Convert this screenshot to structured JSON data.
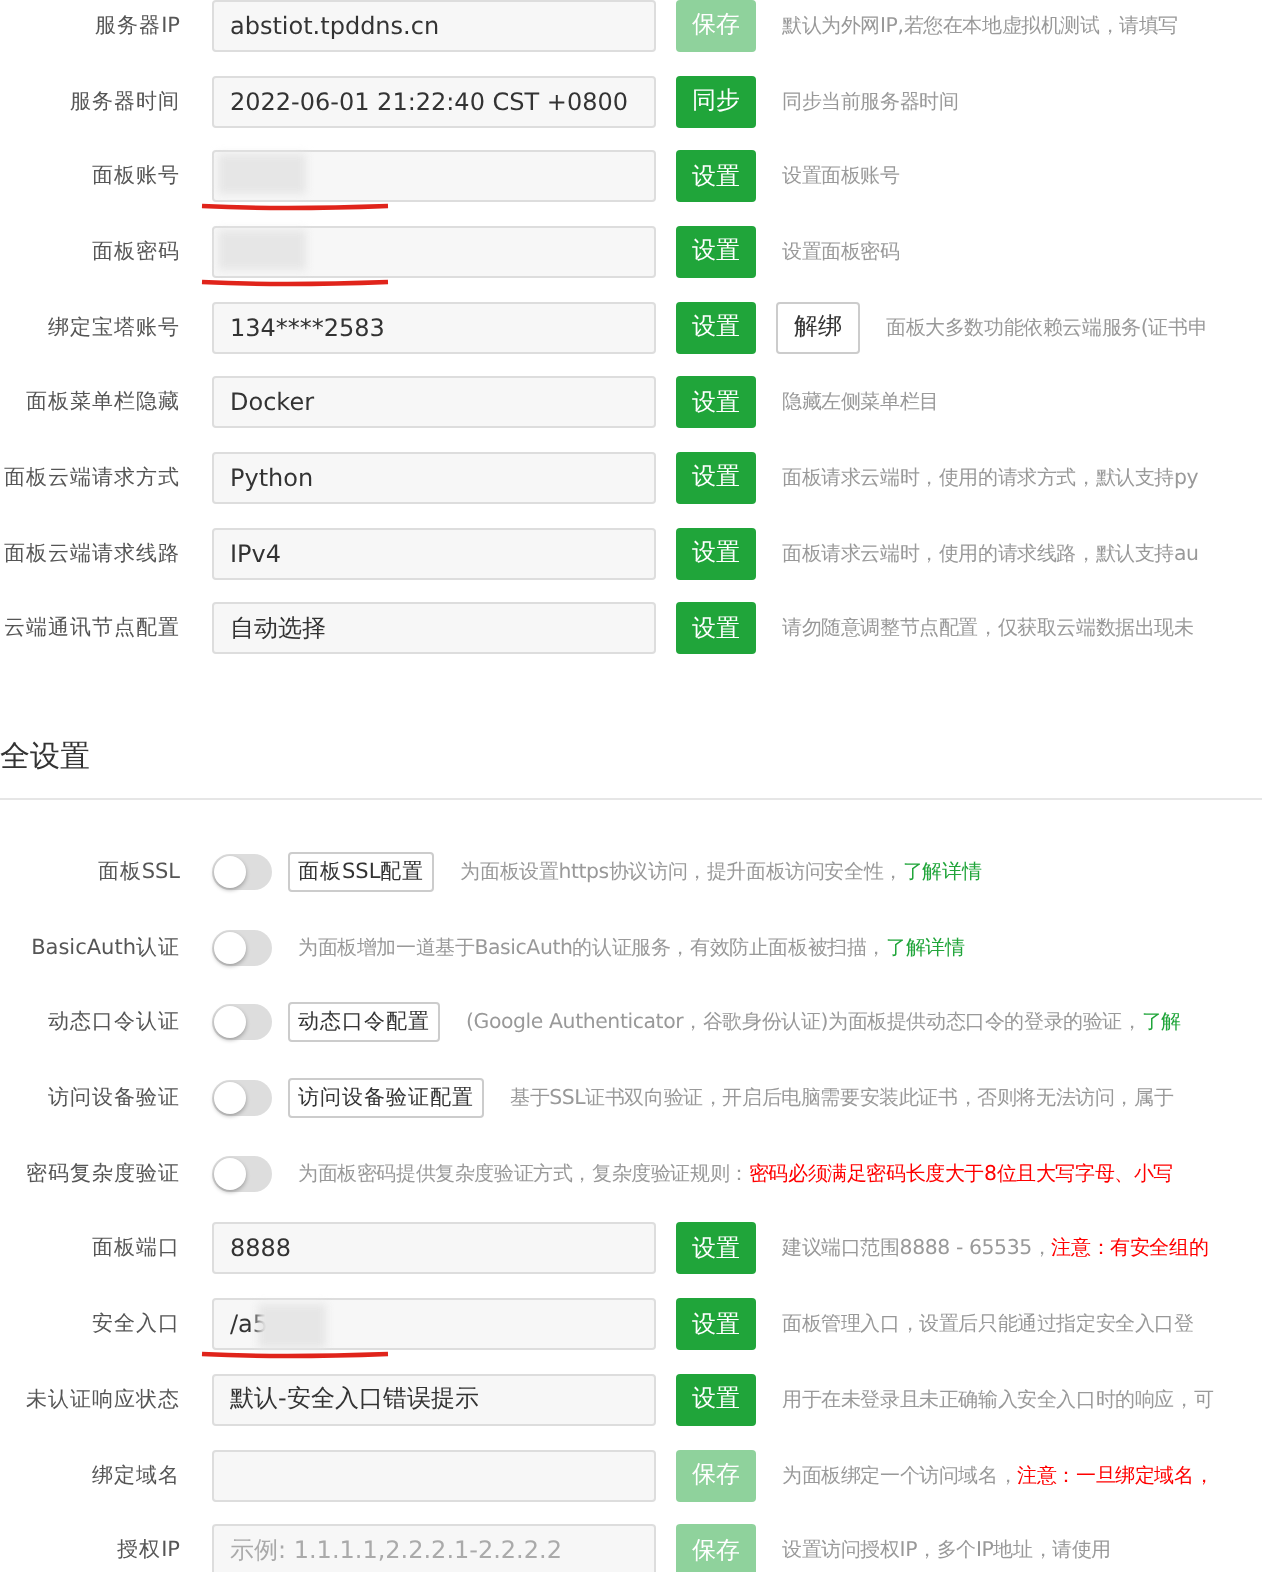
{
  "general_rows": [
    {
      "kind": "input",
      "label": "服务器IP",
      "value": "abstiot.tpddns.cn",
      "redacted": false,
      "button": {
        "label": "保存",
        "disabled": true
      },
      "description": [
        {
          "kind": "plain",
          "text": "默认为外网IP,若您在本地虚拟机测试，请填写"
        }
      ]
    },
    {
      "kind": "input",
      "label": "服务器时间",
      "value": "2022-06-01 21:22:40 CST +0800",
      "redacted": false,
      "button": {
        "label": "同步",
        "disabled": false
      },
      "description": [
        {
          "kind": "plain",
          "text": "同步当前服务器时间"
        }
      ]
    },
    {
      "kind": "input",
      "label": "面板账号",
      "redacted": true,
      "button": {
        "label": "设置",
        "disabled": false
      },
      "description": [
        {
          "kind": "plain",
          "text": "设置面板账号"
        }
      ]
    },
    {
      "kind": "input",
      "label": "面板密码",
      "redacted": true,
      "button": {
        "label": "设置",
        "disabled": false
      },
      "description": [
        {
          "kind": "plain",
          "text": "设置面板密码"
        }
      ]
    },
    {
      "kind": "input",
      "label": "绑定宝塔账号",
      "value": "134****2583",
      "redacted": false,
      "button": {
        "label": "设置",
        "disabled": false
      },
      "extra_button": "解绑",
      "description": [
        {
          "kind": "plain",
          "text": "面板大多数功能依赖云端服务(证书申"
        }
      ]
    },
    {
      "kind": "input",
      "label": "面板菜单栏隐藏",
      "value": "Docker",
      "redacted": false,
      "button": {
        "label": "设置",
        "disabled": false
      },
      "description": [
        {
          "kind": "plain",
          "text": "隐藏左侧菜单栏目"
        }
      ]
    },
    {
      "kind": "input",
      "label": "面板云端请求方式",
      "value": "Python",
      "redacted": false,
      "button": {
        "label": "设置",
        "disabled": false
      },
      "description": [
        {
          "kind": "plain",
          "text": "面板请求云端时，使用的请求方式，默认支持py"
        }
      ]
    },
    {
      "kind": "input",
      "label": "面板云端请求线路",
      "value": "IPv4",
      "redacted": false,
      "button": {
        "label": "设置",
        "disabled": false
      },
      "description": [
        {
          "kind": "plain",
          "text": "面板请求云端时，使用的请求线路，默认支持au"
        }
      ]
    },
    {
      "kind": "input",
      "label": "云端通讯节点配置",
      "value": "自动选择",
      "redacted": false,
      "button": {
        "label": "设置",
        "disabled": false
      },
      "description": [
        {
          "kind": "plain",
          "text": "请勿随意调整节点配置，仅获取云端数据出现未"
        }
      ]
    }
  ],
  "security_heading": "全设置",
  "security_rows": [
    {
      "kind": "toggle",
      "label": "面板SSL",
      "on": false,
      "config_button": "面板SSL配置",
      "description": [
        {
          "kind": "plain",
          "text": "为面板设置https协议访问，提升面板访问安全性，"
        },
        {
          "kind": "link",
          "text": "了解详情"
        }
      ]
    },
    {
      "kind": "toggle",
      "label": "BasicAuth认证",
      "on": false,
      "description": [
        {
          "kind": "plain",
          "text": "为面板增加一道基于BasicAuth的认证服务，有效防止面板被扫描，"
        },
        {
          "kind": "link",
          "text": "了解详情"
        }
      ]
    },
    {
      "kind": "toggle",
      "label": "动态口令认证",
      "on": false,
      "config_button": "动态口令配置",
      "description": [
        {
          "kind": "plain",
          "text": "(Google Authenticator，谷歌身份认证)为面板提供动态口令的登录的验证，"
        },
        {
          "kind": "link",
          "text": "了解"
        }
      ]
    },
    {
      "kind": "toggle",
      "label": "访问设备验证",
      "on": false,
      "config_button": "访问设备验证配置",
      "description": [
        {
          "kind": "plain",
          "text": "基于SSL证书双向验证，开启后电脑需要安装此证书，否则将无法访问，属于"
        }
      ]
    },
    {
      "kind": "toggle",
      "label": "密码复杂度验证",
      "on": false,
      "description": [
        {
          "kind": "plain",
          "text": "为面板密码提供复杂度验证方式，复杂度验证规则："
        },
        {
          "kind": "warn",
          "text": "密码必须满足密码长度大于8位且大写字母、小写"
        }
      ]
    },
    {
      "kind": "input",
      "label": "面板端口",
      "value": "8888",
      "redacted": false,
      "button": {
        "label": "设置",
        "disabled": false
      },
      "description": [
        {
          "kind": "plain",
          "text": "建议端口范围8888 - 65535，"
        },
        {
          "kind": "warn",
          "text": "注意：有安全组的"
        }
      ]
    },
    {
      "kind": "input",
      "label": "安全入口",
      "value": "/a5",
      "redacted": true,
      "button": {
        "label": "设置",
        "disabled": false
      },
      "description": [
        {
          "kind": "plain",
          "text": "面板管理入口，设置后只能通过指定安全入口登"
        }
      ]
    },
    {
      "kind": "input",
      "label": "未认证响应状态",
      "value": "默认-安全入口错误提示",
      "redacted": false,
      "button": {
        "label": "设置",
        "disabled": false
      },
      "description": [
        {
          "kind": "plain",
          "text": "用于在未登录且未正确输入安全入口时的响应，可"
        }
      ]
    },
    {
      "kind": "input",
      "label": "绑定域名",
      "redacted": false,
      "button": {
        "label": "保存",
        "disabled": true
      },
      "description": [
        {
          "kind": "plain",
          "text": "为面板绑定一个访问域名，"
        },
        {
          "kind": "warn",
          "text": "注意：一旦绑定域名，"
        }
      ]
    },
    {
      "kind": "input",
      "label": "授权IP",
      "placeholder": "示例: 1.1.1.1,2.2.2.1-2.2.2.2",
      "redacted": false,
      "button": {
        "label": "保存",
        "disabled": true
      },
      "description": [
        {
          "kind": "plain",
          "text": "设置访问授权IP，多个IP地址，请使用"
        }
      ]
    }
  ]
}
